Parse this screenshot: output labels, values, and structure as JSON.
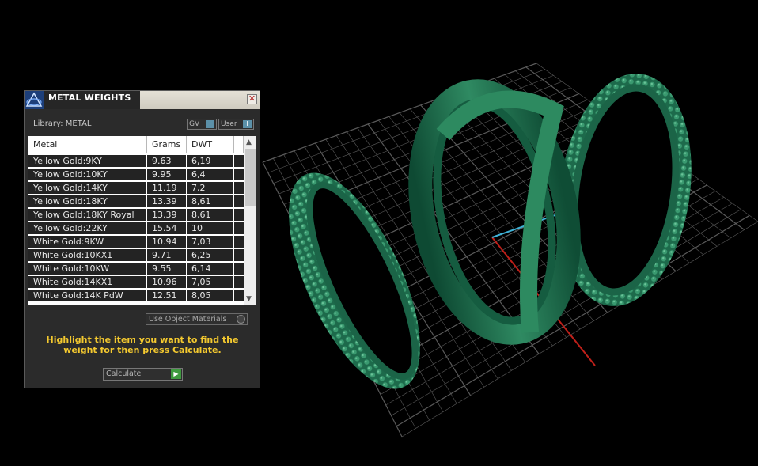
{
  "panel": {
    "title": "METAL WEIGHTS",
    "close_glyph": "✕",
    "library_label": "Library: METAL",
    "toggles": [
      {
        "label": "GV",
        "state_glyph": "I"
      },
      {
        "label": "User",
        "state_glyph": "I"
      }
    ],
    "table": {
      "headers": [
        "Metal",
        "Grams",
        "DWT"
      ],
      "rows": [
        [
          "Yellow Gold:9KY",
          "9.63",
          "6,19"
        ],
        [
          "Yellow Gold:10KY",
          "9.95",
          "6,4"
        ],
        [
          "Yellow Gold:14KY",
          "11.19",
          "7,2"
        ],
        [
          "Yellow Gold:18KY",
          "13.39",
          "8,61"
        ],
        [
          "Yellow Gold:18KY Royal",
          "13.39",
          "8,61"
        ],
        [
          "Yellow Gold:22KY",
          "15.54",
          "10"
        ],
        [
          "White Gold:9KW",
          "10.94",
          "7,03"
        ],
        [
          "White Gold:10KX1",
          "9.71",
          "6,25"
        ],
        [
          "White Gold:10KW",
          "9.55",
          "6,14"
        ],
        [
          "White Gold:14KX1",
          "10.96",
          "7,05"
        ],
        [
          "White Gold:14K PdW",
          "12.51",
          "8,05"
        ]
      ],
      "scroll_up_glyph": "▲",
      "scroll_down_glyph": "▼"
    },
    "use_object_materials_label": "Use Object Materials",
    "instruction_text": "Highlight the item you want to find the weight for then press Calculate.",
    "calculate_label": "Calculate",
    "calculate_glyph": "▶"
  },
  "colors": {
    "viewport_bg": "#000000",
    "grid_line": "#5a5a5a",
    "ring_green": "#1f6f4f",
    "instruction_yellow": "#f4c92f",
    "axis_red": "#c0201a",
    "axis_cyan": "#3fb3d8"
  },
  "icons": {
    "app": "rhino-app-icon",
    "close": "close-icon",
    "go": "play-arrow-icon"
  }
}
